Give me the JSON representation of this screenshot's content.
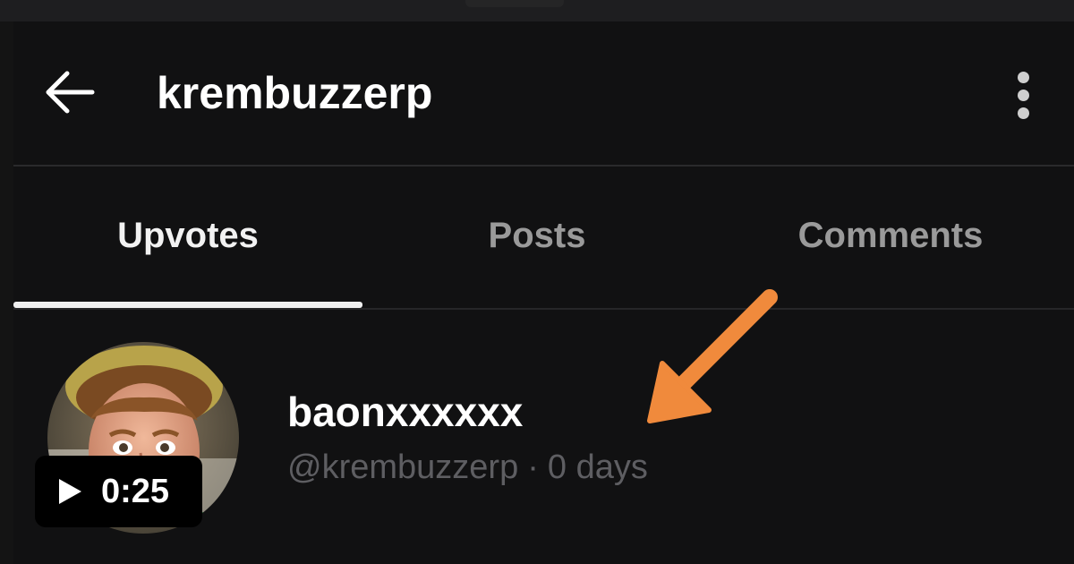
{
  "header": {
    "title": "krembuzzerp",
    "back_icon": "arrow-left-icon",
    "more_icon": "more-vertical-icon"
  },
  "tabs": [
    {
      "label": "Upvotes",
      "active": true
    },
    {
      "label": "Posts",
      "active": false
    },
    {
      "label": "Comments",
      "active": false
    }
  ],
  "list": {
    "items": [
      {
        "username": "baonxxxxxx",
        "handle": "@krembuzzerp",
        "separator": "·",
        "age": "0 days",
        "avatar_icon": "user-avatar"
      }
    ]
  },
  "annotation": {
    "icon": "arrow-annotation",
    "color": "#f08a3c"
  },
  "video_badge": {
    "icon": "play-icon",
    "duration": "0:25"
  },
  "colors": {
    "background": "#111112",
    "text_primary": "#ffffff",
    "text_inactive": "#9a9a9a",
    "text_meta": "#5e5e62",
    "accent_arrow": "#f08a3c"
  }
}
